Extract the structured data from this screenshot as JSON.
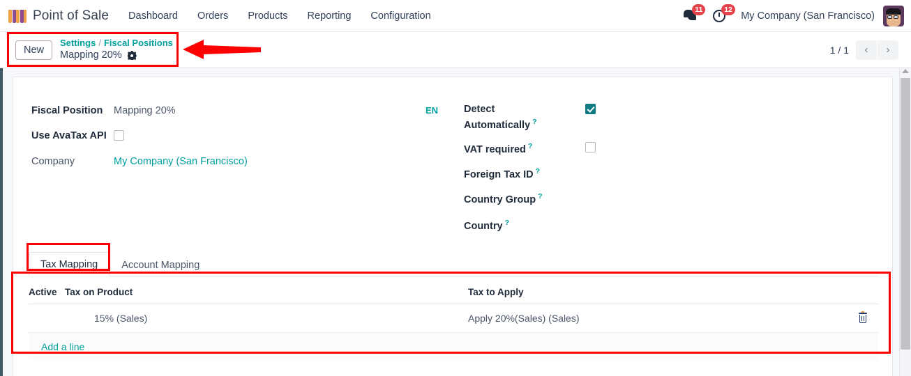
{
  "navbar": {
    "brand": "Point of Sale",
    "logo_icon": "pos-awning-icon",
    "menu_items": [
      {
        "label": "Dashboard"
      },
      {
        "label": "Orders"
      },
      {
        "label": "Products"
      },
      {
        "label": "Reporting"
      },
      {
        "label": "Configuration"
      }
    ],
    "messages_icon": "chat-bubble-icon",
    "messages_count": "11",
    "activities_icon": "clock-icon",
    "activities_count": "12",
    "company": "My Company (San Francisco)",
    "avatar_icon": "user-avatar"
  },
  "control_panel": {
    "new_button": "New",
    "breadcrumb": {
      "root": "Settings",
      "separator": "/",
      "parent": "Fiscal Positions",
      "current": "Mapping 20%",
      "settings_icon": "gear-icon"
    },
    "pager": {
      "count": "1 / 1",
      "prev_icon": "chevron-left-icon",
      "next_icon": "chevron-right-icon"
    }
  },
  "form": {
    "left_fields": {
      "fiscal_position_label": "Fiscal Position",
      "fiscal_position_value": "Mapping 20%",
      "translate_badge": "EN",
      "avatax_label": "Use AvaTax API",
      "avatax_checked": false,
      "company_label": "Company",
      "company_value": "My Company (San Francisco)"
    },
    "right_fields": {
      "detect_label_line1": "Detect",
      "detect_label_line2": "Automatically",
      "detect_checked": true,
      "vat_label": "VAT required",
      "vat_checked": false,
      "foreign_tax_id_label": "Foreign Tax ID",
      "country_group_label": "Country Group",
      "country_label": "Country",
      "help_marker": "?"
    }
  },
  "tabs": [
    {
      "label": "Tax Mapping",
      "active": true
    },
    {
      "label": "Account Mapping",
      "active": false
    }
  ],
  "table": {
    "columns": [
      "Active",
      "Tax on Product",
      "Tax to Apply"
    ],
    "rows": [
      {
        "active": "",
        "tax_on_product": "15% (Sales)",
        "tax_to_apply": "Apply 20%(Sales) (Sales)",
        "delete_icon": "trash-icon"
      }
    ],
    "add_line_label": "Add a line"
  },
  "annotations": {
    "arrow_icon": "red-left-arrow",
    "highlight_color": "#fd0000",
    "boxes": [
      "breadcrumb-highlight",
      "tax-mapping-tab-highlight",
      "tax-mapping-table-highlight"
    ]
  },
  "colors": {
    "accent_teal": "#00a09d",
    "checkbox_teal": "#0f7b82",
    "badge_red": "#e4434b",
    "annotation_red": "#fd0000",
    "text_dark": "#1f2b3a"
  }
}
